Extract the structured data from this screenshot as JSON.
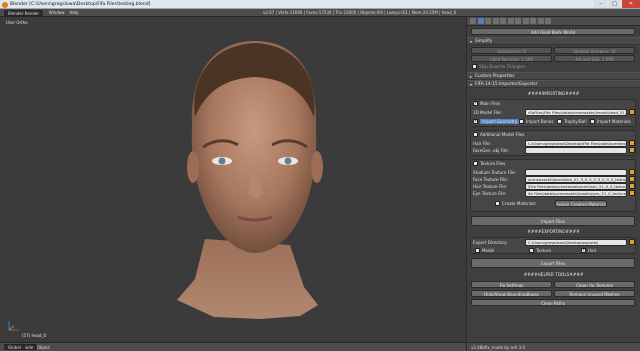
{
  "titlebar": {
    "title": "Blender [C:\\Users\\gregslowa\\Desktop\\Fifa Files\\testing.blend]",
    "min": "–",
    "max": "□",
    "close": "✕"
  },
  "infobar": {
    "menus": [
      "File",
      "Add",
      "Render",
      "Window",
      "Help"
    ],
    "layout": "Default (i)",
    "scene": "Scene",
    "engine": "Blender Render",
    "stats": "v2.67 | Verts:11690 | Faces:17536 | Tris:23000 | Objects:0/9 | Lamps:0/1 | Mem:24.55M | head_0"
  },
  "viewport": {
    "label": "User Ortho",
    "object_name": "(57) head_0"
  },
  "bottombar": {
    "menus": [
      "View",
      "Select",
      "Object"
    ],
    "mode": "Object Mode",
    "global": "Global"
  },
  "panel": {
    "add_rigid": "Add Rigid Body World",
    "simplify": {
      "header": "Simplify",
      "subdivision": "Subdivision: 6",
      "shadow_samples": "Shadow Samples: 16",
      "child_particles": "Child Particles: 1.000",
      "aa_and_sss": "AA and SSS: 1.000",
      "skip_quad": "Skip Quad to Triangles"
    },
    "custom_props": "Custom Properties",
    "fifa": {
      "header": "FIFA 14-15 Importer/Exporter",
      "importing": "####IMPORTING####",
      "main_files": "Main Files",
      "model_label": "3D Model File:",
      "model_path": "rSaFiles\\Fifa Files\\data\\sceneassets\\heads\\head_51_0_0.rx3",
      "import_geometry": "Import Geometry",
      "import_bones": "Import Bones",
      "trophy_ball": "Trophy/Ball",
      "import_materials": "Import Materials",
      "additional": "Additional Model Files",
      "hair_label": "Hair File:",
      "hair_path": "C:\\Users\\gregslowa\\Desktop\\Fifa Files\\data\\sceneassets\\heads\\hair_51_0_0.rx3",
      "facegen_label": "FaceGen .obj File:",
      "texture": "Texture Files",
      "stadium_label": "Stadium Texture File:",
      "face_label": "Face Texture File:",
      "face_path": "sceneassets\\faces\\face_51_0_0_0_0_0_0_0_0_textures.rx3",
      "hair_tex_label": "Hair Texture File:",
      "hair_tex_path": "\\Fifa Files\\data\\sceneassets\\hair\\hair_51_0_0_textures.rx3",
      "eye_label": "Eye Texture File:",
      "eye_path": "ifa Files\\data\\sceneassets\\heads\\eyes_51_0_textures.rx3",
      "create_materials": "Create Materials",
      "assign_materials": "Assign Created Materials",
      "import_files": "Import Files",
      "exporting": "####EXPORTING####",
      "export_dir_label": "Export Directory:",
      "export_dir": "C:\\Users\\gregslowa\\Desktop\\exports\\",
      "model": "Model",
      "textures": "Texture",
      "hair": "Hair",
      "export_files": "Export Files",
      "helper": "####HELPER TOOLS####",
      "fix_settings": "Fix Settings",
      "clean_textures": "Clean Up Textures",
      "hide_bounding": "Hide/Show BoundingBoxes",
      "remove_meshes": "Remove Unused Meshes",
      "clean_paths": "Clean Paths"
    },
    "status": "v2.48bfix_mode by arti 3.0"
  },
  "colors": {
    "accent": "#e87d0d",
    "selected_tab": "#5680c2",
    "field_bg": "#e6e6e6"
  }
}
